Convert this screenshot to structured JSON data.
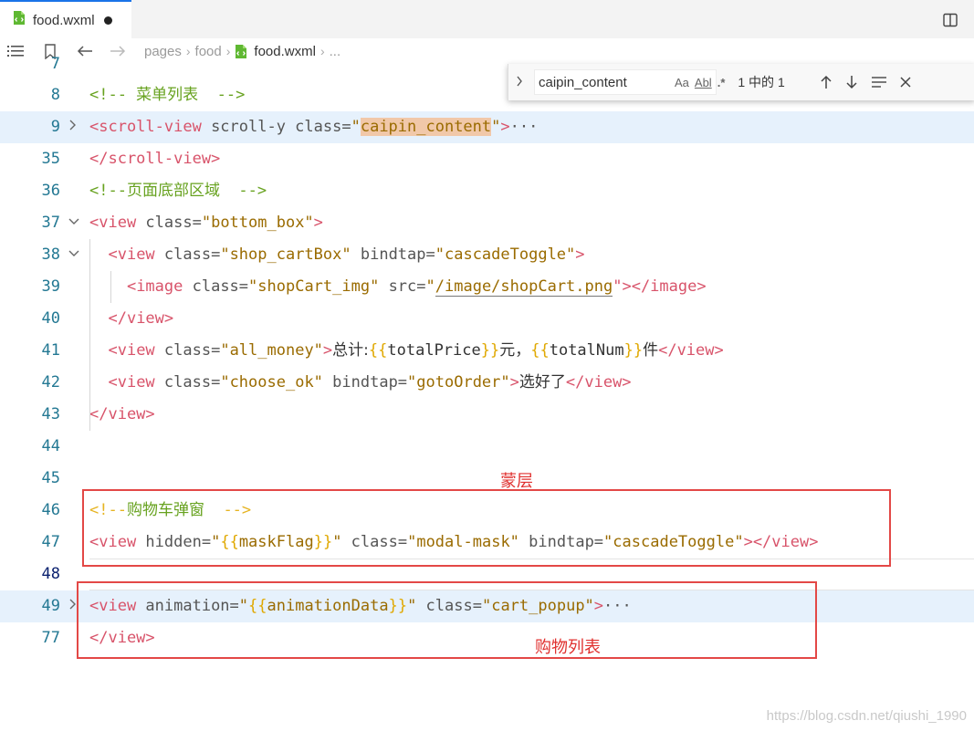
{
  "tab": {
    "title": "food.wxml"
  },
  "breadcrumb": {
    "items": [
      "pages",
      "food",
      "food.wxml",
      "..."
    ]
  },
  "find": {
    "query": "caipin_content",
    "opt_case": "Aa",
    "opt_word": "Abl",
    "opt_regex": ".*",
    "count": "1 中的 1"
  },
  "editor": {
    "partial_top_line": "7",
    "lines": [
      {
        "num": "8",
        "comment": "<!-- 菜单列表  -->"
      },
      {
        "num": "9",
        "open": "<scroll-view",
        "attr1": " scroll-y class=",
        "q1": "\"",
        "str1": "caipin_content",
        "q2": "\"",
        "close": ">",
        "ellipsis": "···"
      },
      {
        "num": "35",
        "tag": "</scroll-view>"
      },
      {
        "num": "36",
        "comment": "<!--页面底部区域  -->"
      },
      {
        "num": "37",
        "open": "<view",
        "attr1": " class=",
        "str1": "\"bottom_box\"",
        "close": ">"
      },
      {
        "num": "38",
        "open": "<view",
        "attr1": " class=",
        "str1": "\"shop_cartBox\"",
        "attr2": " bindtap=",
        "str2": "\"cascadeToggle\"",
        "close": ">"
      },
      {
        "num": "39",
        "open": "<image",
        "attr1": " class=",
        "str1": "\"shopCart_img\"",
        "attr2": " src=",
        "q": "\"",
        "src": "/image/shopCart.png",
        "close": "\"></image>"
      },
      {
        "num": "40",
        "tag": "</view>"
      },
      {
        "num": "41",
        "open": "<view",
        "attr1": " class=",
        "str1": "\"all_money\"",
        "gt": ">",
        "t1": "总计:",
        "b1": "{{",
        "v1": "totalPrice",
        "b2": "}}",
        "t2": "元，",
        "b3": "{{",
        "v2": "totalNum",
        "b4": "}}",
        "t3": "件",
        "close": "</view>"
      },
      {
        "num": "42",
        "open": "<view",
        "attr1": " class=",
        "str1": "\"choose_ok\"",
        "attr2": " bindtap=",
        "str2": "\"gotoOrder\"",
        "gt": ">",
        "t1": "选好了",
        "close": "</view>"
      },
      {
        "num": "43",
        "tag": "</view>"
      },
      {
        "num": "44"
      },
      {
        "num": "45"
      },
      {
        "num": "46",
        "comment_a": "<!--",
        "comment_b": "购物车弹窗  ",
        "comment_c": "-->"
      },
      {
        "num": "47",
        "open": "<view",
        "attr1": " hidden=",
        "q1": "\"",
        "b1": "{{",
        "v1": "maskFlag",
        "b2": "}}",
        "q2": "\"",
        "attr2": " class=",
        "str2": "\"modal-mask\"",
        "attr3": " bindtap=",
        "str3": "\"cascadeToggle\"",
        "close": "></view>"
      },
      {
        "num": "48"
      },
      {
        "num": "49",
        "open": "<view",
        "attr1": " animation=",
        "q1": "\"",
        "b1": "{{",
        "v1": "animationData",
        "b2": "}}",
        "q2": "\"",
        "attr2": " class=",
        "str2": "\"cart_popup\"",
        "close": ">",
        "ellipsis": "···"
      },
      {
        "num": "77",
        "tag": "</view>"
      }
    ]
  },
  "annotations": {
    "mask_label": "蒙层",
    "list_label": "购物列表"
  },
  "watermark": "https://blog.csdn.net/qiushi_1990",
  "colors": {
    "accent": "#1a73e8",
    "annotation_red": "#e34846",
    "line_highlight": "#e6f1fc"
  }
}
